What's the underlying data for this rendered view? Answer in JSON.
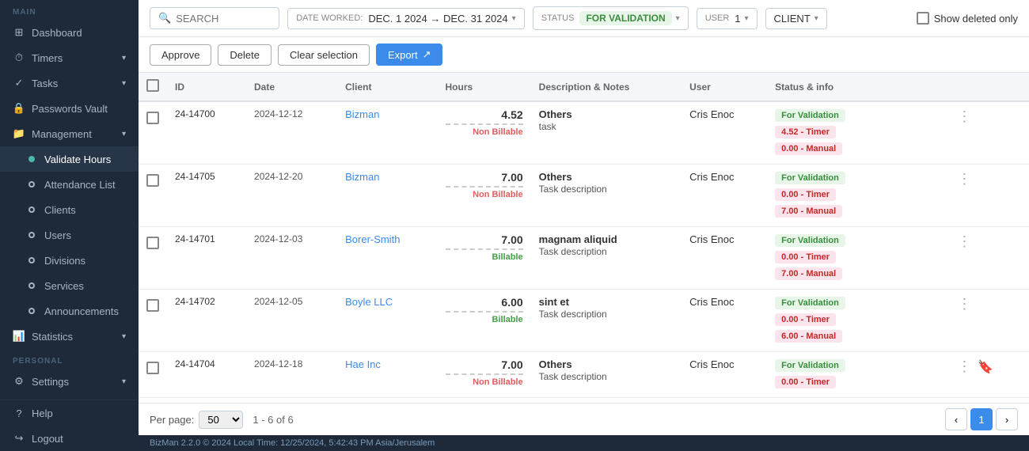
{
  "sidebar": {
    "main_label": "MAIN",
    "personal_label": "PERSONAL",
    "items": [
      {
        "id": "dashboard",
        "label": "Dashboard",
        "icon": "grid"
      },
      {
        "id": "timers",
        "label": "Timers",
        "icon": "clock",
        "has_chevron": true
      },
      {
        "id": "tasks",
        "label": "Tasks",
        "icon": "check",
        "has_chevron": true
      },
      {
        "id": "passwords",
        "label": "Passwords Vault",
        "icon": "lock",
        "has_chevron": false
      },
      {
        "id": "management",
        "label": "Management",
        "icon": "folder",
        "has_chevron": true
      },
      {
        "id": "validate-hours",
        "label": "Validate Hours",
        "icon": "dot-filled",
        "active": true
      },
      {
        "id": "attendance",
        "label": "Attendance List",
        "icon": "dot"
      },
      {
        "id": "clients",
        "label": "Clients",
        "icon": "dot"
      },
      {
        "id": "users",
        "label": "Users",
        "icon": "dot"
      },
      {
        "id": "divisions",
        "label": "Divisions",
        "icon": "dot"
      },
      {
        "id": "services",
        "label": "Services",
        "icon": "dot"
      },
      {
        "id": "announcements",
        "label": "Announcements",
        "icon": "dot"
      },
      {
        "id": "statistics",
        "label": "Statistics",
        "icon": "bar-chart",
        "has_chevron": true
      },
      {
        "id": "settings",
        "label": "Settings",
        "icon": "gear",
        "has_chevron": true
      },
      {
        "id": "help",
        "label": "Help",
        "icon": "question"
      },
      {
        "id": "logout",
        "label": "Logout",
        "icon": "logout"
      }
    ]
  },
  "topbar": {
    "search_placeholder": "SEARCH",
    "date_label": "DATE WORKED:",
    "date_value": "DEC. 1 2024 → DEC. 31 2024",
    "status_label": "STATUS",
    "status_value": "FOR VALIDATION",
    "user_label": "USER",
    "user_value": "1",
    "client_label": "CLIENT",
    "show_deleted_label": "Show deleted only"
  },
  "actionbar": {
    "approve_label": "Approve",
    "delete_label": "Delete",
    "clear_label": "Clear selection",
    "export_label": "Export"
  },
  "table": {
    "columns": [
      "",
      "ID",
      "Date",
      "Client",
      "Hours",
      "Description & Notes",
      "User",
      "Status & info",
      ""
    ],
    "rows": [
      {
        "id": "24-14700",
        "date": "2024-12-12",
        "client": "Bizman",
        "hours_val": "4.52",
        "hours_sep": true,
        "hours_type": "Non Billable",
        "desc_title": "Others",
        "desc_sub": "task",
        "user": "Cris Enoc",
        "status": "For Validation",
        "timer": "4.52 - Timer",
        "manual": "0.00 - Manual"
      },
      {
        "id": "24-14705",
        "date": "2024-12-20",
        "client": "Bizman",
        "hours_val": "7.00",
        "hours_sep": true,
        "hours_type": "Non Billable",
        "desc_title": "Others",
        "desc_sub": "Task description",
        "user": "Cris Enoc",
        "status": "For Validation",
        "timer": "0.00 - Timer",
        "manual": "7.00 - Manual"
      },
      {
        "id": "24-14701",
        "date": "2024-12-03",
        "client": "Borer-Smith",
        "hours_val": "7.00",
        "hours_sep": true,
        "hours_type": "Billable",
        "desc_title": "magnam aliquid",
        "desc_sub": "Task description",
        "user": "Cris Enoc",
        "status": "For Validation",
        "timer": "0.00 - Timer",
        "manual": "7.00 - Manual"
      },
      {
        "id": "24-14702",
        "date": "2024-12-05",
        "client": "Boyle LLC",
        "hours_val": "6.00",
        "hours_sep": true,
        "hours_type": "Billable",
        "desc_title": "sint et",
        "desc_sub": "Task description",
        "user": "Cris Enoc",
        "status": "For Validation",
        "timer": "0.00 - Timer",
        "manual": "6.00 - Manual"
      },
      {
        "id": "24-14704",
        "date": "2024-12-18",
        "client": "Hae Inc",
        "hours_val": "7.00",
        "hours_sep": true,
        "hours_type": "Non Billable",
        "desc_title": "Others",
        "desc_sub": "Task description",
        "user": "Cris Enoc",
        "status": "For Validation",
        "timer": "0.00 - Timer",
        "manual": ""
      }
    ]
  },
  "footer": {
    "per_page_label": "Per page:",
    "per_page_value": "50",
    "range_label": "1 - 6 of 6"
  },
  "statusbar": {
    "text": "BizMan 2.2.0 © 2024    Local Time: 12/25/2024, 5:42:43 PM  Asia/Jerusalem"
  }
}
